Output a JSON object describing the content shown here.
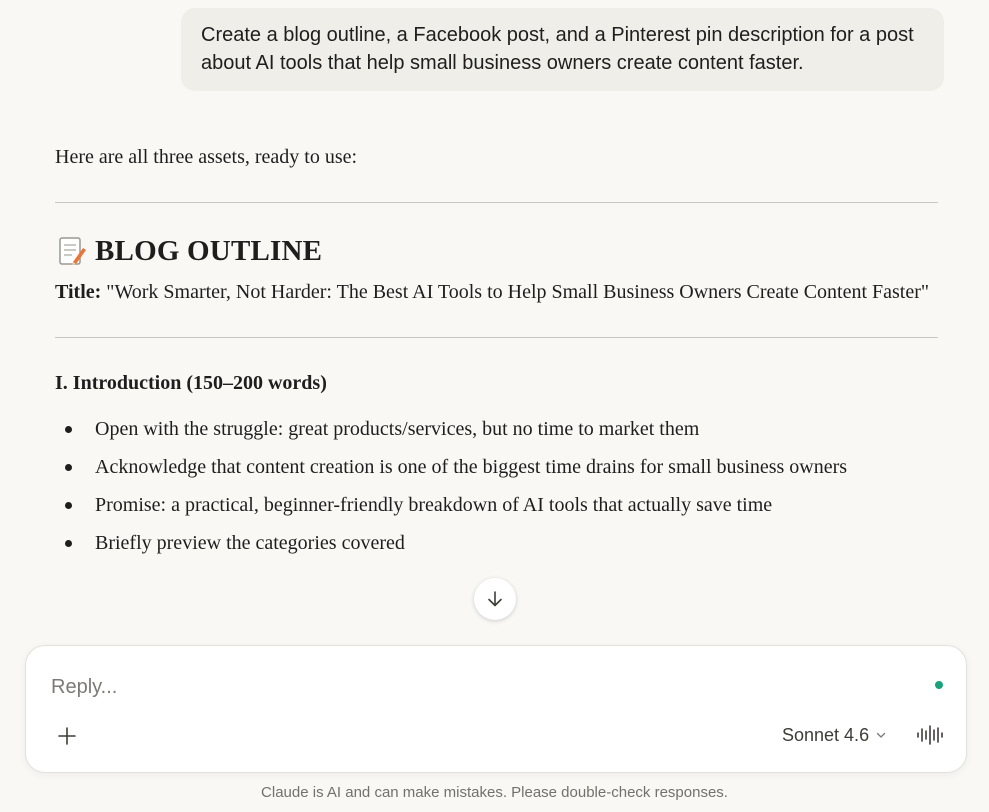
{
  "user_message": {
    "text": "Create a blog outline, a Facebook post, and a Pinterest pin description for a post about AI tools that help small business owners create content faster."
  },
  "response": {
    "intro": "Here are all three assets, ready to use:",
    "blog_heading": "BLOG OUTLINE",
    "blog_heading_icon": "memo-icon",
    "title_label": "Title:",
    "title_value": " \"Work Smarter, Not Harder: The Best AI Tools to Help Small Business Owners Create Content Faster\"",
    "section_heading": "I. Introduction (150–200 words)",
    "bullets": [
      "Open with the struggle: great products/services, but no time to market them",
      "Acknowledge that content creation is one of the biggest time drains for small business owners",
      "Promise: a practical, beginner-friendly breakdown of AI tools that actually save time",
      "Briefly preview the categories covered"
    ]
  },
  "scroll_button": {
    "icon": "arrow-down-icon"
  },
  "composer": {
    "placeholder": "Reply...",
    "add_icon": "plus-icon",
    "model_label": "Sonnet 4.6",
    "model_chevron_icon": "chevron-down-icon",
    "voice_icon": "voice-waveform-icon",
    "status_color": "#1aa37a"
  },
  "disclaimer": "Claude is AI and can make mistakes. Please double-check responses."
}
